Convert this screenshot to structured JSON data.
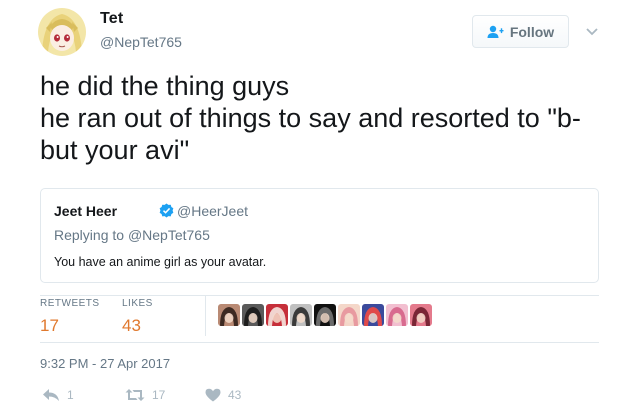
{
  "author": {
    "name": "Tet",
    "handle": "@NepTet765"
  },
  "follow_button": {
    "label": "Follow",
    "icon": "follow-person-plus-icon"
  },
  "tweet": {
    "lines": [
      "he did the thing guys",
      "he ran out of things to say and resorted to \"b-",
      "but your avi\""
    ]
  },
  "quoted_tweet": {
    "name": "Jeet Heer",
    "handle": "@HeerJeet",
    "replying_prefix": "Replying to ",
    "replying_handle": "@NepTet765",
    "text": "You have an anime girl as your avatar.",
    "verified_icon": "verified-badge-icon"
  },
  "stats": {
    "retweets_label": "RETWEETS",
    "retweets_value": "17",
    "likes_label": "LIKES",
    "likes_value": "43"
  },
  "timestamp": "9:32 PM - 27 Apr 2017",
  "actions": {
    "reply_count": "1",
    "retweet_count": "17",
    "like_count": "43"
  },
  "colors": {
    "accent": "#1da1f2",
    "stat_value": "#e0792e",
    "muted_text": "#657786",
    "border": "#e1e8ed",
    "action_icon": "#aab8c2"
  },
  "liker_avatars": [
    {
      "name": "liker-avatar-1",
      "bg": "#b98a74",
      "fg": "#3d2a22"
    },
    {
      "name": "liker-avatar-2",
      "bg": "#5a5a5a",
      "fg": "#1e1e1e"
    },
    {
      "name": "liker-avatar-3",
      "bg": "#c62f3a",
      "fg": "#f1d4cf"
    },
    {
      "name": "liker-avatar-4",
      "bg": "#c0c0c0",
      "fg": "#3a3a3a"
    },
    {
      "name": "liker-avatar-5",
      "bg": "#111111",
      "fg": "#6b6b6b"
    },
    {
      "name": "liker-avatar-6",
      "bg": "#f4d7c9",
      "fg": "#e89aa0"
    },
    {
      "name": "liker-avatar-7",
      "bg": "#3b4a9c",
      "fg": "#e04a4a"
    },
    {
      "name": "liker-avatar-8",
      "bg": "#f2bfd0",
      "fg": "#d86b8f"
    },
    {
      "name": "liker-avatar-9",
      "bg": "#e47a8c",
      "fg": "#7a2636"
    }
  ]
}
